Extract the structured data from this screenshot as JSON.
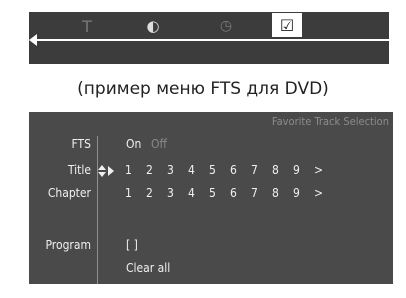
{
  "topbar": {
    "icons": [
      {
        "name": "text-icon",
        "glyph": "T"
      },
      {
        "name": "disc-icon",
        "glyph": "◐"
      },
      {
        "name": "clock-icon",
        "glyph": "◷"
      },
      {
        "name": "checkbox-icon",
        "glyph": "☑"
      }
    ]
  },
  "caption": "(пример меню FTS для DVD)",
  "menu": {
    "header": "Favorite Track Selection",
    "fts": {
      "label": "FTS",
      "on": "On",
      "off": "Off"
    },
    "title": {
      "label": "Title",
      "items": [
        "1",
        "2",
        "3",
        "4",
        "5",
        "6",
        "7",
        "8",
        "9",
        ">"
      ]
    },
    "chapter": {
      "label": "Chapter",
      "items": [
        "1",
        "2",
        "3",
        "4",
        "5",
        "6",
        "7",
        "8",
        "9",
        ">"
      ]
    },
    "program": {
      "label": "Program",
      "value": "[ ]",
      "clear": "Clear all"
    }
  },
  "colors": {
    "panel": "#4a4a4a",
    "topbar": "#3c3c3c",
    "text": "#f0f0f0",
    "dim": "#8a8a8a"
  }
}
